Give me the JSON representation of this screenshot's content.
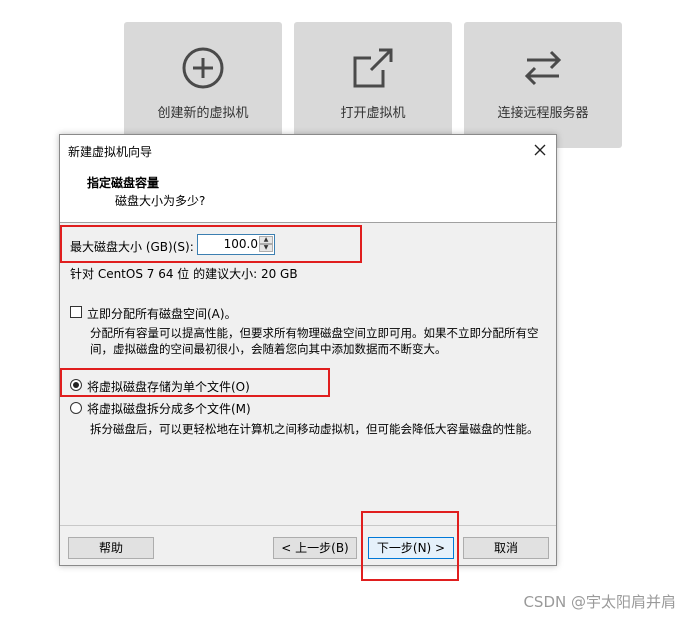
{
  "tiles": [
    {
      "label": "创建新的虚拟机",
      "icon": "plus-circle-icon"
    },
    {
      "label": "打开虚拟机",
      "icon": "external-link-icon"
    },
    {
      "label": "连接远程服务器",
      "icon": "swap-arrows-icon"
    }
  ],
  "dialog": {
    "title": "新建虚拟机向导",
    "header_title": "指定磁盘容量",
    "header_subtitle": "磁盘大小为多少?",
    "max_size_label": "最大磁盘大小 (GB)(S):",
    "max_size_value": "100.0",
    "recommend_text": "针对 CentOS 7 64 位 的建议大小: 20 GB",
    "allocate_label": "立即分配所有磁盘空间(A)。",
    "allocate_checked": false,
    "allocate_desc": "分配所有容量可以提高性能，但要求所有物理磁盘空间立即可用。如果不立即分配所有空间，虚拟磁盘的空间最初很小，会随着您向其中添加数据而不断变大。",
    "single_file_label": "将虚拟磁盘存储为单个文件(O)",
    "single_file_selected": true,
    "split_label": "将虚拟磁盘拆分成多个文件(M)",
    "split_desc": "拆分磁盘后，可以更轻松地在计算机之间移动虚拟机，但可能会降低大容量磁盘的性能。",
    "buttons": {
      "help": "帮助",
      "back": "< 上一步(B)",
      "next": "下一步(N) >",
      "cancel": "取消"
    }
  },
  "watermark": "CSDN @宇太阳肩并肩",
  "colors": {
    "highlight": "#e01e1e",
    "tile_bg": "#d9d9d9",
    "dialog_bg": "#f0f0f0",
    "primary_border": "#0078d7"
  }
}
